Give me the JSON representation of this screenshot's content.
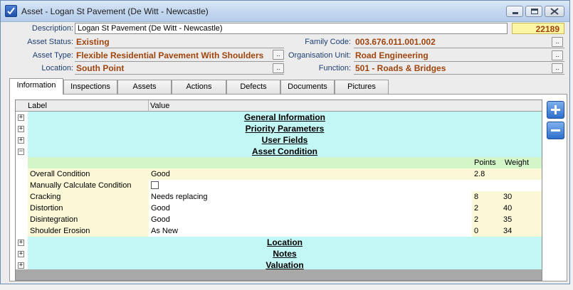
{
  "window": {
    "title": "Asset - Logan St Pavement (De Witt - Newcastle)"
  },
  "header": {
    "description_label": "Description:",
    "description_value": "Logan St Pavement (De Witt - Newcastle)",
    "asset_number": "22189",
    "asset_status_label": "Asset Status:",
    "asset_status_value": "Existing",
    "asset_type_label": "Asset Type:",
    "asset_type_value": "Flexible Residential Pavement With Shoulders",
    "location_label": "Location:",
    "location_value": "South Point",
    "family_code_label": "Family Code:",
    "family_code_value": "003.676.011.001.002",
    "org_unit_label": "Organisation Unit:",
    "org_unit_value": "Road Engineering",
    "function_label": "Function:",
    "function_value": "501 - Roads & Bridges",
    "lookup_button": ".."
  },
  "tabs": [
    "Information",
    "Inspections",
    "Assets",
    "Actions",
    "Defects",
    "Documents",
    "Pictures"
  ],
  "grid": {
    "col_label": "Label",
    "col_value": "Value",
    "sections_top": [
      "General Information",
      "Priority Parameters",
      "User Fields"
    ],
    "condition_section": "Asset Condition",
    "points_header": "Points",
    "weight_header": "Weight",
    "rows": [
      {
        "label": "Overall Condition",
        "value": "Good",
        "points": "2.8",
        "weight": ""
      },
      {
        "label": "Manually Calculate Condition",
        "value": "",
        "points": "",
        "weight": ""
      },
      {
        "label": "Cracking",
        "value": "Needs replacing",
        "points": "8",
        "weight": "30"
      },
      {
        "label": "Distortion",
        "value": "Good",
        "points": "2",
        "weight": "40"
      },
      {
        "label": "Disintegration",
        "value": "Good",
        "points": "2",
        "weight": "35"
      },
      {
        "label": "Shoulder Erosion",
        "value": "As New",
        "points": "0",
        "weight": "34"
      }
    ],
    "sections_bottom": [
      "Location",
      "Notes",
      "Valuation"
    ],
    "expander_plus": "+",
    "expander_minus": "−"
  },
  "colors": {
    "section_bg": "#c3f7f5",
    "label_bg": "#fbf8d8",
    "value_text": "#a0440d",
    "asset_number_bg": "#fbf5a4"
  }
}
